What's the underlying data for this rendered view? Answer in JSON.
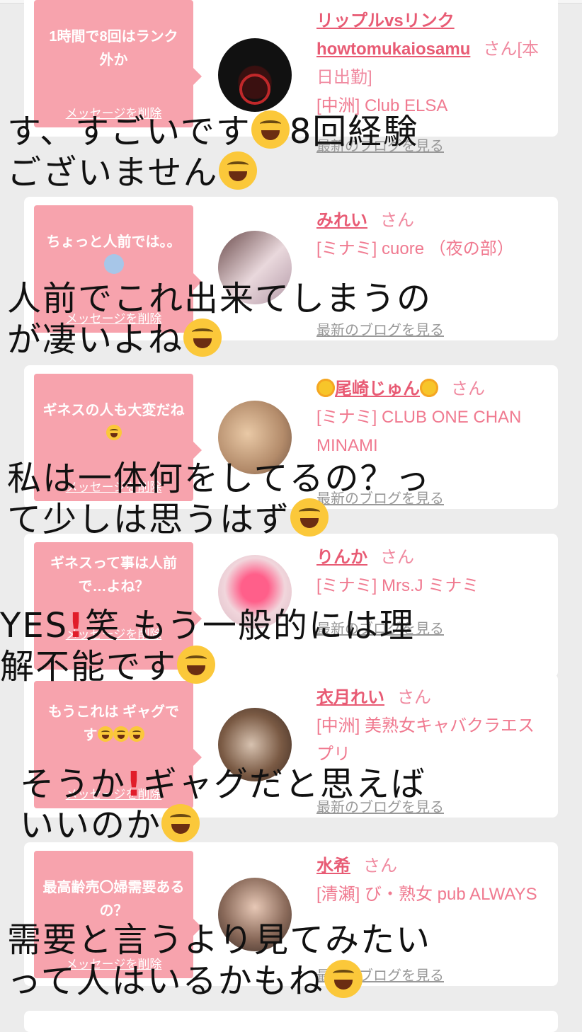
{
  "cards": [
    {
      "message": "1時間で8回はランク外か",
      "delete_label": "メッセージを削除",
      "name": "リップルvsリンクhowtomukaiosamu",
      "honorific": "さん[本日出勤]",
      "shop": "[中洲] Club ELSA",
      "blog_link": "最新のブログを見る"
    },
    {
      "message": "ちょっと人前では。。",
      "message_emoji": "fearful-face-emoji",
      "delete_label": "メッセージを削除",
      "name": "みれい",
      "honorific": "さん",
      "shop": "[ミナミ] cuore （夜の部）",
      "blog_link": "最新のブログを見る"
    },
    {
      "message": "ギネスの人も大変だね",
      "message_emoji": "rofl-emoji",
      "delete_label": "メッセージを削除",
      "name": "尾崎じゅん",
      "name_decoration": "sunflower-emoji",
      "honorific": "さん",
      "shop": "[ミナミ] CLUB ONE CHAN MINAMI",
      "blog_link": "最新のブログを見る"
    },
    {
      "message": "ギネスって事は人前で…よね？",
      "delete_label": "メッセージを削除",
      "name": "りんか",
      "honorific": "さん",
      "shop": "[ミナミ] Mrs.J ミナミ",
      "blog_link": "最新のブログを見る"
    },
    {
      "message": "もうこれは ギャグです",
      "message_emoji": "rofl-emoji x3",
      "delete_label": "メッセージを削除",
      "name": "衣月れい",
      "honorific": "さん",
      "shop": "[中洲] 美熟女キャバクラエスプリ",
      "blog_link": "最新のブログを見る"
    },
    {
      "message": "最高齢売〇婦需要あるの？",
      "delete_label": "メッセージを削除",
      "name": "水希",
      "honorific": "さん",
      "shop": "[清瀬] び・熟女 pub ALWAYS",
      "blog_link": "最新のブログを見る"
    }
  ],
  "overlay": [
    {
      "line1": "す、すごいです",
      "line1_tail": "8回経験",
      "line2": "ございません"
    },
    {
      "line1": "人前でこれ出来てしまうの",
      "line2": "が凄いよね"
    },
    {
      "line1": "私は一体何をしてるの？っ",
      "line2": "て少しは思うはず"
    },
    {
      "line1a": "YES",
      "line1b": "笑 もう一般的には理",
      "line2": "解不能です"
    },
    {
      "line1a": "そうか",
      "line1b": "ギャグだと思えば",
      "line2": "いいのか"
    },
    {
      "line1": "需要と言うより見てみたい",
      "line2": "って人はいるかもね"
    }
  ],
  "icons": {
    "rofl": "rolling-on-floor-laughing-emoji",
    "joy": "face-with-tears-of-joy-emoji",
    "exclamation": "red-exclamation-mark"
  },
  "colors": {
    "bubble": "#f7a3ad",
    "name": "#e85b74",
    "shop": "#f07a90"
  }
}
